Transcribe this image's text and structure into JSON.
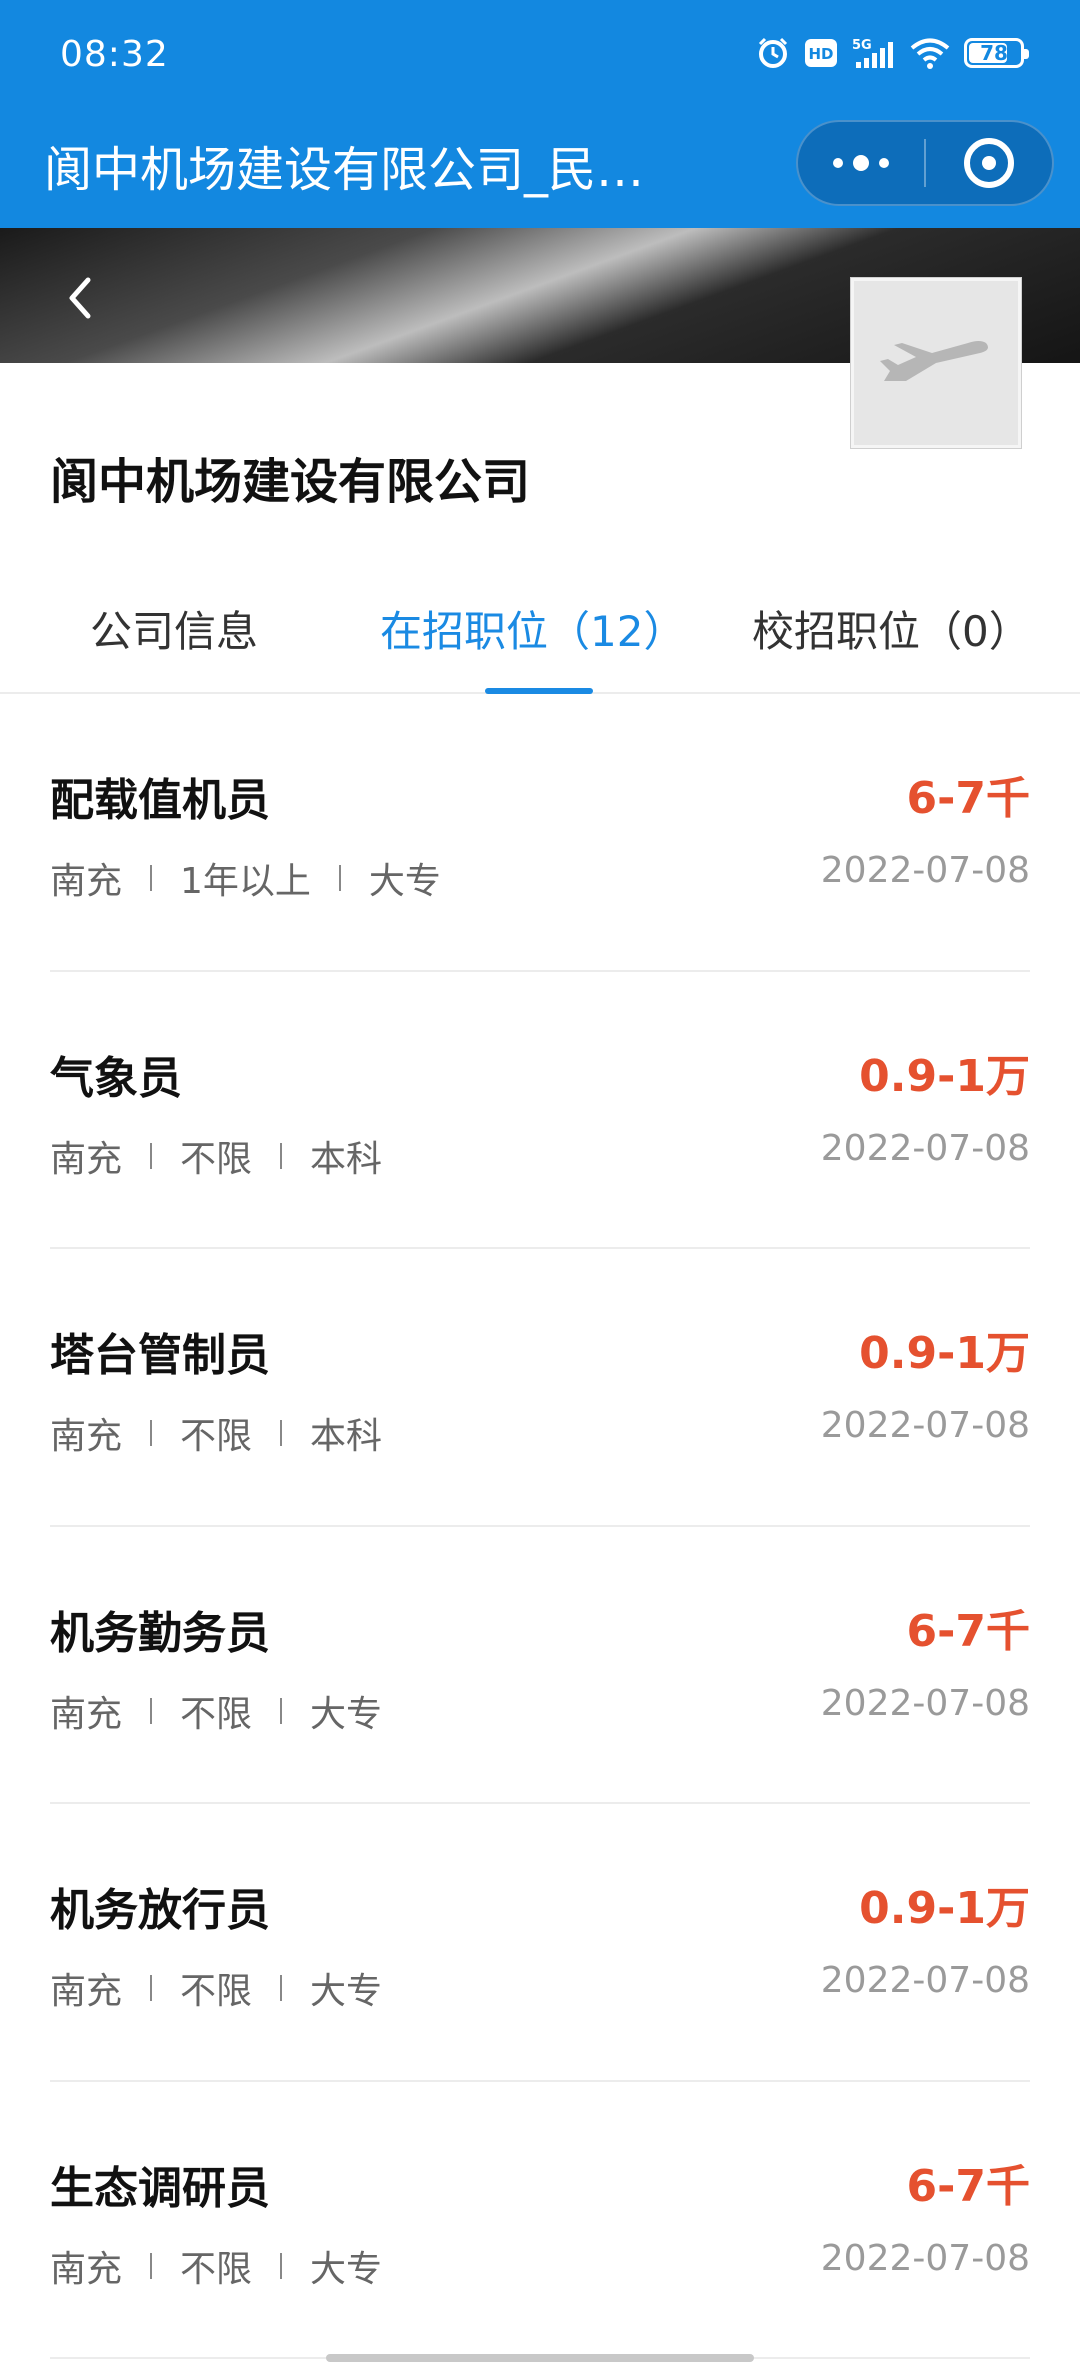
{
  "status_bar": {
    "time": "08:32",
    "battery": "78",
    "battery_level": 0.78,
    "icons": [
      "alarm-icon",
      "hd-icon",
      "5g-signal-icon",
      "wifi-icon",
      "battery-icon"
    ]
  },
  "nav": {
    "title": "阆中机场建设有限公司_民…",
    "more_icon": "more-dots-icon",
    "close_icon": "target-circle-icon"
  },
  "company": {
    "name": "阆中机场建设有限公司",
    "logo_icon": "airplane-icon"
  },
  "tabs": [
    {
      "label": "公司信息",
      "active": false
    },
    {
      "label": "在招职位（12）",
      "active": true
    },
    {
      "label": "校招职位（0）",
      "active": false
    }
  ],
  "jobs": [
    {
      "title": "配载值机员",
      "salary": "6-7千",
      "location": "南充",
      "experience": "1年以上",
      "education": "大专",
      "date": "2022-07-08"
    },
    {
      "title": "气象员",
      "salary": "0.9-1万",
      "location": "南充",
      "experience": "不限",
      "education": "本科",
      "date": "2022-07-08"
    },
    {
      "title": "塔台管制员",
      "salary": "0.9-1万",
      "location": "南充",
      "experience": "不限",
      "education": "本科",
      "date": "2022-07-08"
    },
    {
      "title": "机务勤务员",
      "salary": "6-7千",
      "location": "南充",
      "experience": "不限",
      "education": "大专",
      "date": "2022-07-08"
    },
    {
      "title": "机务放行员",
      "salary": "0.9-1万",
      "location": "南充",
      "experience": "不限",
      "education": "大专",
      "date": "2022-07-08"
    },
    {
      "title": "生态调研员",
      "salary": "6-7千",
      "location": "南充",
      "experience": "不限",
      "education": "大专",
      "date": "2022-07-08"
    }
  ],
  "colors": {
    "header_blue": "#1388e0",
    "tab_active": "#1a8ae3",
    "salary_red": "#e5512f"
  }
}
